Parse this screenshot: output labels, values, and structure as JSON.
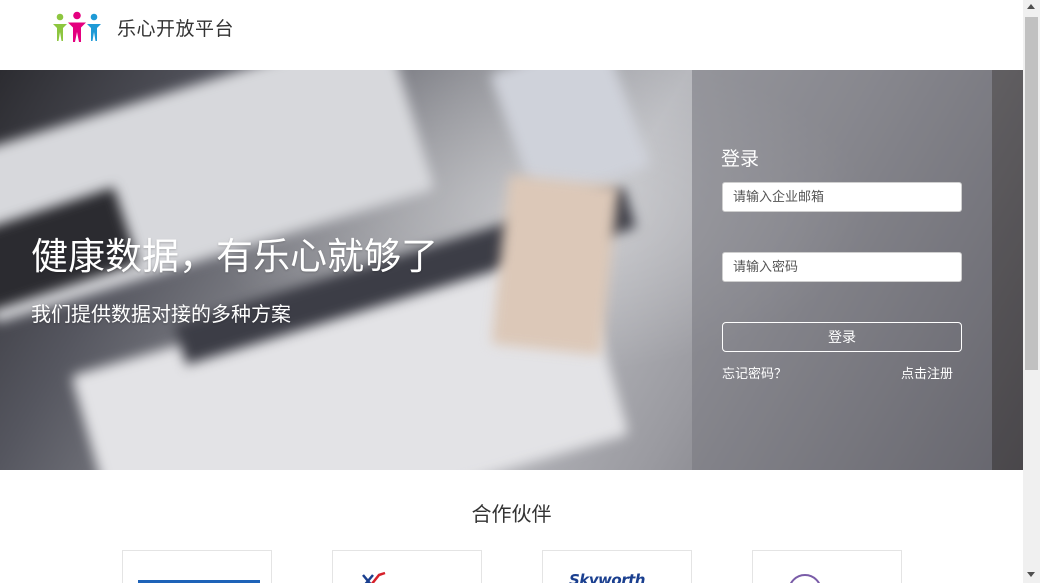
{
  "header": {
    "brand_name": "乐心开放平台",
    "logo_colors": [
      "#8dc63f",
      "#e4007f",
      "#1e9ad6"
    ]
  },
  "hero": {
    "title": "健康数据，有乐心就够了",
    "subtitle": "我们提供数据对接的多种方案"
  },
  "login": {
    "title": "登录",
    "email_placeholder": "请输入企业邮箱",
    "password_placeholder": "请输入密码",
    "submit_label": "登录",
    "forgot_label": "忘记密码？",
    "register_label": "点击注册"
  },
  "partners": {
    "title": "合作伙伴",
    "items": [
      {
        "logo_text": ""
      },
      {
        "logo_text": ""
      },
      {
        "logo_text": "Skyworth"
      },
      {
        "logo_text": ""
      }
    ]
  },
  "icons": {
    "logo": "people-group-icon",
    "scroll_up": "arrow-up-icon",
    "scroll_down": "arrow-down-icon"
  }
}
